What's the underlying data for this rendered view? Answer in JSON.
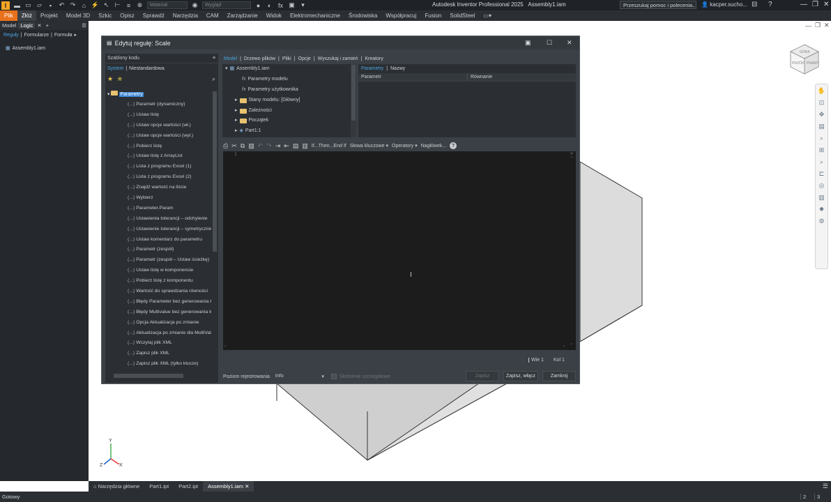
{
  "titlebar": {
    "material_placeholder": "Materiał",
    "appearance_placeholder": "Wygląd",
    "app_title": "Autodesk Inventor Professional 2025",
    "doc_title": "Assembly1.iam",
    "help_search": "Przeszukaj pomoc i polecenia...",
    "user": "kacper.sucho..."
  },
  "menu": [
    "Plik",
    "Złóż",
    "Projekt",
    "Model 3D",
    "Szkic",
    "Opisz",
    "Sprawdź",
    "Narzędzia",
    "CAM",
    "Zarządzanie",
    "Widok",
    "Elektromechaniczne",
    "Środowiska",
    "Współpracuj",
    "Fusion",
    "SolidSteel"
  ],
  "browser": {
    "tab_model": "Model",
    "tab_logic": "Logic",
    "sub_rules": "Reguły",
    "sub_forms": "Formularze",
    "sub_formula": "Formuła",
    "item": "Assembly1.iam"
  },
  "dialog": {
    "title": "Edytuj regułę: Scale",
    "snippets_header": "Szablony kodu",
    "sub_system": "System",
    "sub_custom": "Niestandardowa",
    "root": "Parametry",
    "snippets": [
      "Parametr (dynamiczny)",
      "Ustaw listę",
      "Ustaw opcje wartości (wł.)",
      "Ustaw opcje wartości (wył.)",
      "Pobierz listę",
      "Ustaw listę z ArrayList",
      "Lista z programu Excel (1)",
      "Lista z programu Excel (2)",
      "Znajdź wartość na liście",
      "Wybierz",
      "Parameter.Param",
      "Ustawienia tolerancji – odchylenie",
      "Ustawienie tolerancji – symetrycznie",
      "Ustaw komentarz do parametru",
      "Parametr (zespół)",
      "Parametr (zespół – Ustaw ścieżkę)",
      "Ustaw listę w komponencie",
      "Pobierz listę z komponentu",
      "Wartość do sprawdzania równości",
      "Błędy Parameter bez generowania ko",
      "Błędy Multivalue bez generowania ko",
      "Opcja Aktualizacja po zmianie",
      "Aktualizacja po zmianie dla MultiValue",
      "Wczytaj plik XML",
      "Zapisz plik XML",
      "Zapisz plik XML (tylko klucze)"
    ],
    "top_tabs": [
      "Model",
      "Drzewo plików",
      "Pliki",
      "Opcje",
      "Wyszukaj i zamień",
      "Kreatory"
    ],
    "model_tree": {
      "root": "Assembly1.iam",
      "model_params": "Parametry modelu",
      "user_params": "Parametry użytkownika",
      "model_states": "Stany modelu: [Główny]",
      "relations": "Zależności",
      "origin": "Początek",
      "part": "Part1:1"
    },
    "param_tabs": [
      "Parametry",
      "Nazwy"
    ],
    "param_cols": [
      "Parametr",
      "Równanie"
    ],
    "toolbar": {
      "ifthen": "If...Then...End If",
      "keywords": "Słowa kluczowe",
      "operators": "Operatory",
      "header": "Nagłówek..."
    },
    "line_number": "1",
    "line_label": "Wie 1",
    "col_label": "Kol 1",
    "log_level_label": "Poziom rejestrowania",
    "log_level_value": "Info",
    "detail_tracking": "Śledzenie szczegółowe",
    "btn_save": "Zapisz",
    "btn_save_run": "Zapisz, włącz",
    "btn_close": "Zamknij"
  },
  "doc_tabs": [
    "Narzędzia główne",
    "Part1.ipt",
    "Part2.ipt",
    "Assembly1.iam"
  ],
  "status": {
    "text": "Gotowy",
    "count1": "2",
    "count2": "3"
  },
  "viewcube": {
    "top": "GÓRA",
    "front": "PRZÓD",
    "right": "PRAWY"
  }
}
